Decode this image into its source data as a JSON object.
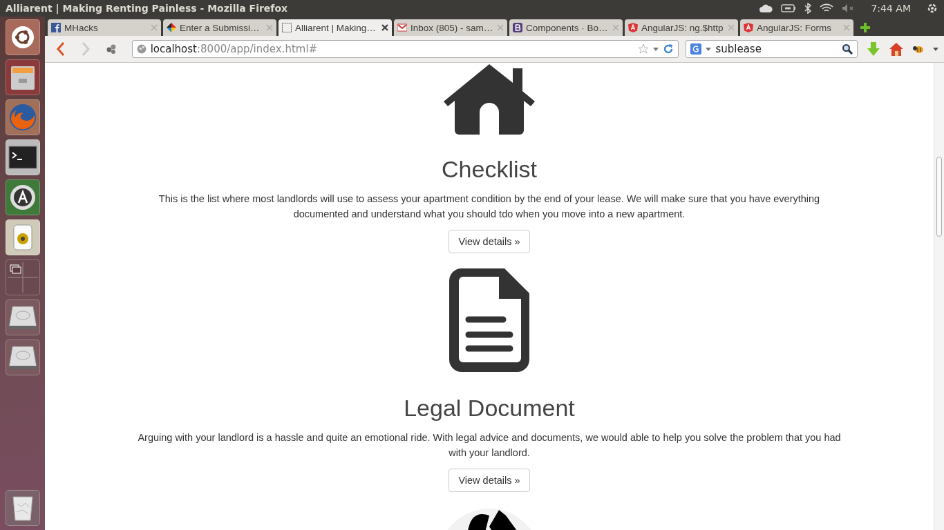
{
  "panel": {
    "title": "Alliarent | Making Renting Painless - Mozilla Firefox",
    "clock": "7:44 AM"
  },
  "tabs": [
    {
      "label": "MHacks",
      "kind": "facebook",
      "selected": false
    },
    {
      "label": "Enter a Submissi…",
      "kind": "colorful",
      "selected": false
    },
    {
      "label": "Alliarent | Making…",
      "kind": "blank",
      "selected": true
    },
    {
      "label": "Inbox (805) - sam…",
      "kind": "mail",
      "selected": false
    },
    {
      "label": "Components · Bo…",
      "kind": "bootstrap",
      "selected": false
    },
    {
      "label": "AngularJS: ng.$http",
      "kind": "angular",
      "selected": false
    },
    {
      "label": "AngularJS: Forms",
      "kind": "angular",
      "selected": false
    }
  ],
  "address": {
    "host": "localhost",
    "path": ":8000/app/index.html#"
  },
  "search": {
    "value": "sublease"
  },
  "sections": [
    {
      "kind": "house",
      "title": "Checklist",
      "text": "This is the list where most landlords will use to assess your apartment condition by the end of your lease. We will make sure that you have everything documented and understand what you should tdo when you move into a new apartment.",
      "button": "View details »"
    },
    {
      "kind": "document",
      "title": "Legal Document",
      "text": "Arguing with your landlord is a hassle and quite an emotional ride. With legal advice and documents, we would able to help you solve the problem that you had with your landlord.",
      "button": "View details »"
    },
    {
      "kind": "tools"
    }
  ]
}
